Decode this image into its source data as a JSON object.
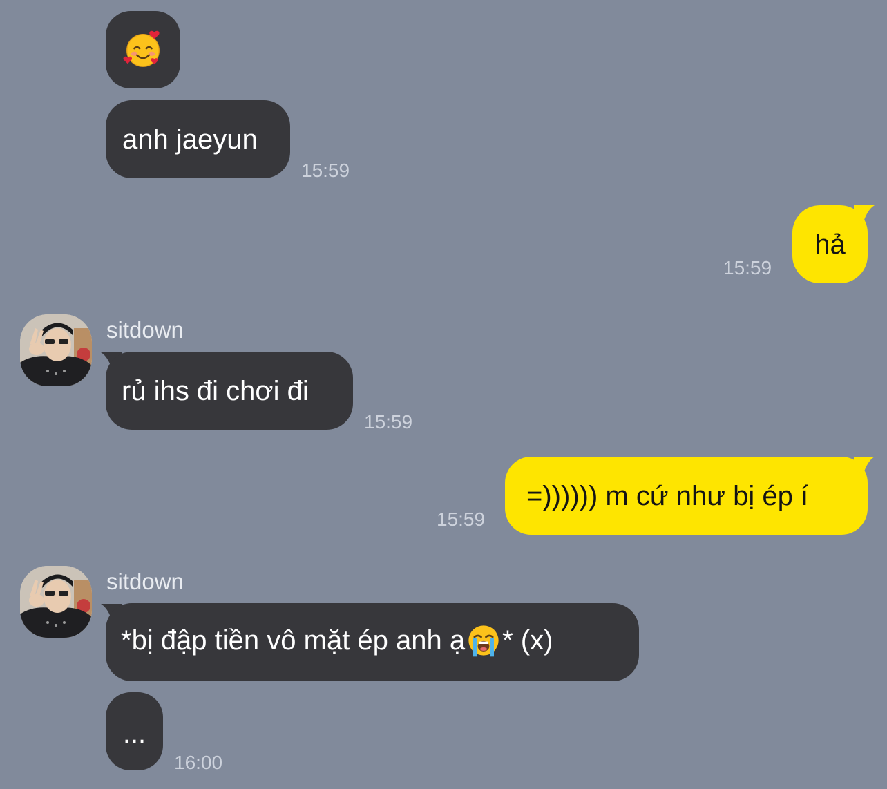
{
  "conversation": {
    "messages": [
      {
        "sender": "other",
        "emoji": "smiling-face-with-hearts",
        "time": ""
      },
      {
        "sender": "other",
        "text": "anh jaeyun",
        "time": "15:59"
      },
      {
        "sender": "me",
        "text": "hả",
        "time": "15:59"
      },
      {
        "sender": "other",
        "name": "sitdown",
        "text": "rủ ihs đi chơi đi",
        "time": "15:59"
      },
      {
        "sender": "me",
        "text": "=)))))) m cứ như bị ép í",
        "time": "15:59"
      },
      {
        "sender": "other",
        "name": "sitdown",
        "text_before_emoji": "*bị đập tiền vô mặt ép anh ạ",
        "emoji": "loudly-crying-face",
        "text_after_emoji": "* (x)",
        "time": ""
      },
      {
        "sender": "other",
        "text": "...",
        "time": "16:00"
      }
    ]
  },
  "colors": {
    "background": "#818a9b",
    "incoming_bubble": "#37373b",
    "outgoing_bubble": "#fee500"
  }
}
